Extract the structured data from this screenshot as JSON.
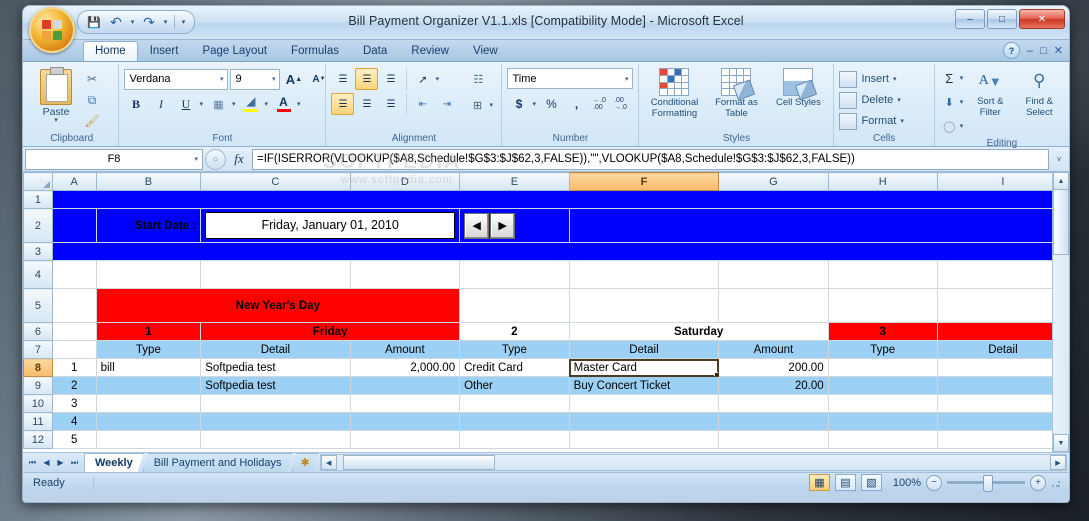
{
  "window": {
    "title": "Bill Payment Organizer V1.1.xls  [Compatibility Mode] - Microsoft Excel",
    "minimize": "–",
    "maximize": "□",
    "close": "✕",
    "watermark": "EDIA"
  },
  "quick_access": {
    "save": "💾",
    "undo": "↶",
    "redo": "↷",
    "customize": "▾"
  },
  "tabs": [
    {
      "label": "Home",
      "active": true
    },
    {
      "label": "Insert",
      "active": false
    },
    {
      "label": "Page Layout",
      "active": false
    },
    {
      "label": "Formulas",
      "active": false
    },
    {
      "label": "Data",
      "active": false
    },
    {
      "label": "Review",
      "active": false
    },
    {
      "label": "View",
      "active": false
    }
  ],
  "tab_right": {
    "help": "?",
    "minimize_ribbon": "–",
    "restore": "□",
    "close": "✕"
  },
  "ribbon": {
    "clipboard": {
      "label": "Clipboard",
      "paste": "Paste",
      "paste_caret": "▾",
      "cut": "✂",
      "copy": "⧉",
      "format_painter": "🖌",
      "dialog": "↘"
    },
    "font": {
      "label": "Font",
      "font_name": "Verdana",
      "font_size": "9",
      "grow": "A",
      "shrink": "A",
      "bold": "B",
      "italic": "I",
      "underline": "U",
      "borders": "▦",
      "fill_color": "▲",
      "font_color": "A",
      "fill_swatch": "#ffff00",
      "font_swatch": "#ff0000",
      "dialog": "↘"
    },
    "alignment": {
      "label": "Alignment",
      "top": "≡",
      "middle": "≡",
      "bottom": "≡",
      "orientation": "↗",
      "wrap_text": "☰",
      "align_left": "≡",
      "align_center": "≡",
      "align_right": "≡",
      "decrease_indent": "⇤",
      "increase_indent": "⇥",
      "merge_center": "⊞",
      "dialog": "↘"
    },
    "number": {
      "label": "Number",
      "format": "Time",
      "accounting": "$",
      "percent": "%",
      "comma": ",",
      "increase_decimal": ".00",
      "decrease_decimal": ".00",
      "dialog": "↘"
    },
    "styles": {
      "label": "Styles",
      "conditional_formatting": "Conditional Formatting",
      "format_as_table": "Format as Table",
      "cell_styles": "Cell Styles"
    },
    "cells": {
      "label": "Cells",
      "insert": "Insert",
      "delete": "Delete",
      "format": "Format"
    },
    "editing": {
      "label": "Editing",
      "autosum": "Σ",
      "fill": "↓",
      "clear": "⬭",
      "sort_filter": "Sort & Filter",
      "find_select": "Find & Select"
    }
  },
  "formula_bar": {
    "name_box": "F8",
    "cancel": "✕",
    "enter": "✓",
    "insert_function": "fx",
    "formula": "=IF(ISERROR(VLOOKUP($A8,Schedule!$G$3:$J$62,3,FALSE)),\"\",VLOOKUP($A8,Schedule!$G$3:$J$62,3,FALSE))",
    "expand": "˅"
  },
  "sheet": {
    "column_headers": [
      "A",
      "B",
      "C",
      "D",
      "E",
      "F",
      "G",
      "H",
      "I"
    ],
    "selected_column": "F",
    "selected_row": "8",
    "row_numbers": [
      "1",
      "2",
      "3",
      "4",
      "5",
      "6",
      "7",
      "8",
      "9",
      "10",
      "11",
      "12"
    ],
    "start_date_label": "Start Date :",
    "start_date_value": "Friday, January 01, 2010",
    "spin_prev": "◀",
    "spin_next": "▶",
    "holiday_banner": "New Year's Day",
    "days": [
      {
        "number": "1",
        "name": "Friday",
        "holiday": true
      },
      {
        "number": "2",
        "name": "Saturday",
        "holiday": false
      },
      {
        "number": "3",
        "name": "",
        "holiday": true
      }
    ],
    "sub_headers": [
      "Type",
      "Detail",
      "Amount",
      "Type",
      "Detail",
      "Amount",
      "Type",
      "Detail"
    ],
    "rows": [
      {
        "n": "1",
        "excel_row": "8",
        "c1_type": "bill",
        "c1_detail": "Softpedia test",
        "c1_amount": "2,000.00",
        "c2_type": "Credit Card",
        "c2_detail": "Master Card",
        "c2_amount": "200.00",
        "c3_type": "",
        "c3_detail": ""
      },
      {
        "n": "2",
        "excel_row": "9",
        "c1_type": "",
        "c1_detail": "Softpedia test",
        "c1_amount": "",
        "c2_type": "Other",
        "c2_detail": "Buy Concert Ticket",
        "c2_amount": "20.00",
        "c3_type": "",
        "c3_detail": ""
      },
      {
        "n": "3",
        "excel_row": "10",
        "c1_type": "",
        "c1_detail": "",
        "c1_amount": "",
        "c2_type": "",
        "c2_detail": "",
        "c2_amount": "",
        "c3_type": "",
        "c3_detail": ""
      },
      {
        "n": "4",
        "excel_row": "11",
        "c1_type": "",
        "c1_detail": "",
        "c1_amount": "",
        "c2_type": "",
        "c2_detail": "",
        "c2_amount": "",
        "c3_type": "",
        "c3_detail": ""
      },
      {
        "n": "5",
        "excel_row": "12",
        "c1_type": "",
        "c1_detail": "",
        "c1_amount": "",
        "c2_type": "",
        "c2_detail": "",
        "c2_amount": "",
        "c3_type": "",
        "c3_detail": ""
      }
    ],
    "selected_cell_value": "Master Card",
    "watermark": "SOFTPEDIA",
    "watermark_url": "www.softpedia.com"
  },
  "sheet_tabs": {
    "first": "⏮",
    "prev": "◀",
    "next": "▶",
    "last": "⏭",
    "items": [
      {
        "label": "Weekly",
        "active": true
      },
      {
        "label": "Bill Payment and Holidays",
        "active": false
      }
    ],
    "new_sheet": "✱"
  },
  "status_bar": {
    "status": "Ready",
    "view_normal": "▦",
    "view_layout": "▤",
    "view_break": "▧",
    "zoom_level": "100%",
    "zoom_out": "−",
    "zoom_in": "+"
  },
  "colors": {
    "holiday_red": "#ff0000",
    "band_blue": "#0000ff",
    "header_blue": "#9cd0f5",
    "selection_orange": "#f6bc6c"
  }
}
